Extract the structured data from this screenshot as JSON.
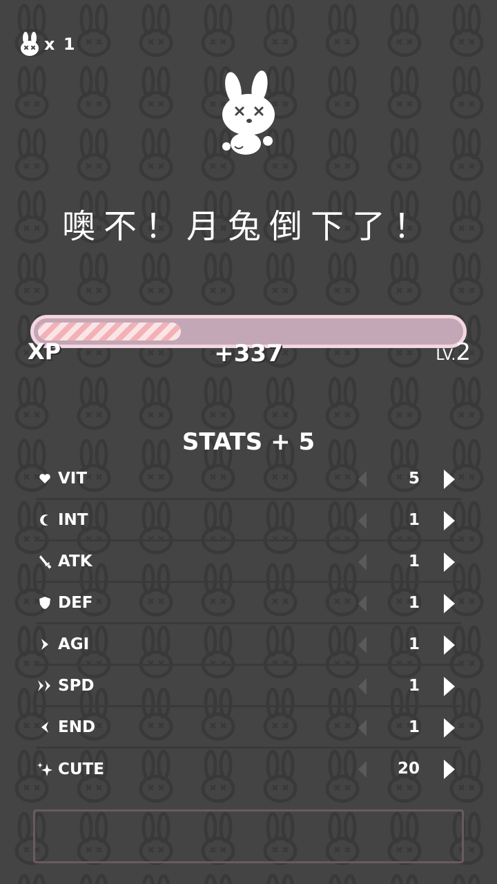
{
  "hud": {
    "lives_text": "x 1"
  },
  "game_over": {
    "title": "噢不！月兔倒下了！"
  },
  "xp": {
    "label": "XP",
    "gain": "+337",
    "level_prefix": "LV.",
    "level_value": "2",
    "progress_fraction": 0.34
  },
  "stats": {
    "title": "STATS + 5",
    "items": [
      {
        "name": "VIT",
        "value": "5",
        "icon": "heart-icon"
      },
      {
        "name": "INT",
        "value": "1",
        "icon": "moon-icon"
      },
      {
        "name": "ATK",
        "value": "1",
        "icon": "sword-icon"
      },
      {
        "name": "DEF",
        "value": "1",
        "icon": "shield-icon"
      },
      {
        "name": "AGI",
        "value": "1",
        "icon": "chevron-right-icon"
      },
      {
        "name": "SPD",
        "value": "1",
        "icon": "double-chevron-right-icon"
      },
      {
        "name": "END",
        "value": "1",
        "icon": "chevron-left-icon"
      },
      {
        "name": "CUTE",
        "value": "20",
        "icon": "sparkle-icon"
      }
    ]
  },
  "colors": {
    "background": "#444444",
    "xp_bar_border": "#f3d6df",
    "xp_bar_track": "#c3a7b6",
    "xp_fill_stripe_a": "#f2b1b7",
    "xp_fill_stripe_b": "#fbe4e6",
    "text": "#ffffff",
    "disabled_arrow": "#5a5a5a"
  }
}
